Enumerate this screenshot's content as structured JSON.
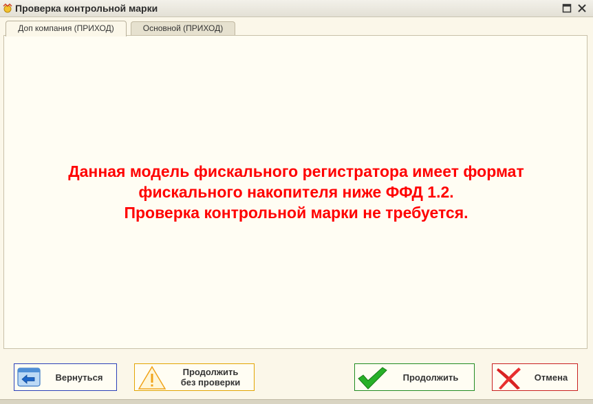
{
  "window": {
    "title": "Проверка контрольной марки"
  },
  "tabs": [
    {
      "label": "Доп компания (ПРИХОД)",
      "active": true
    },
    {
      "label": "Основной (ПРИХОД)",
      "active": false
    }
  ],
  "message": {
    "line1": "Данная модель фискального регистратора имеет формат",
    "line2": "фискального накопителя ниже ФФД 1.2.",
    "line3": "Проверка контрольной марки не требуется.",
    "color": "#ff0000"
  },
  "buttons": {
    "back": {
      "label": "Вернуться",
      "icon": "back-arrow-icon",
      "border_color": "#2a3fb8"
    },
    "skip": {
      "label_line1": "Продолжить",
      "label_line2": "без проверки",
      "icon": "warning-icon",
      "border_color": "#e2a400"
    },
    "continue": {
      "label": "Продолжить",
      "icon": "checkmark-icon",
      "border_color": "#1f8a1f"
    },
    "cancel": {
      "label": "Отмена",
      "icon": "cross-icon",
      "border_color": "#c81e1e"
    }
  }
}
